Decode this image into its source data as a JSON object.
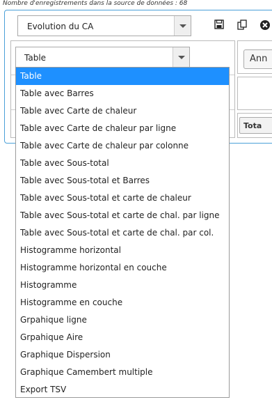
{
  "top_note": "Nombre d'enregistrements dans la source de données : 68",
  "report_select": {
    "value": "Evolution du CA"
  },
  "icons": [
    "save-icon",
    "copy-icon",
    "close-icon"
  ],
  "type_select": {
    "value": "Table"
  },
  "side_buttons": {
    "ann_label": "Ann",
    "tota_label": "Tota"
  },
  "dropdown": {
    "selected_index": 0,
    "options": [
      "Table",
      "Table avec Barres",
      "Table avec Carte de chaleur",
      "Table avec Carte de chaleur par ligne",
      "Table avec Carte de chaleur par colonne",
      "Table avec Sous-total",
      "Table avec Sous-total et Barres",
      "Table avec Sous-total et carte de chaleur",
      "Table avec Sous-total et carte de chal. par ligne",
      "Table avec Sous-total et carte de chal. par col.",
      "Histogramme horizontal",
      "Histogramme horizontal en couche",
      "Histogramme",
      "Histogramme en couche",
      "Grpahique ligne",
      "Grpahique Aire",
      "Graphique Dispersion",
      "Graphique Camembert multiple",
      "Export TSV"
    ]
  },
  "colors": {
    "accent": "#1e90ff",
    "panel_border": "#4aa0d8"
  }
}
